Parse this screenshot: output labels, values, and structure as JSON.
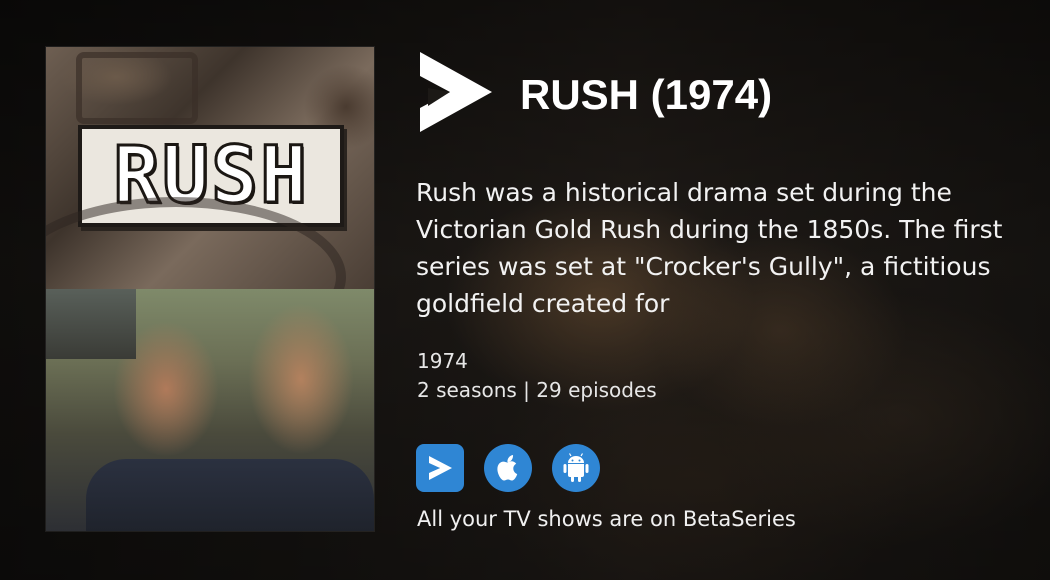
{
  "show": {
    "title": "RUSH (1974)",
    "poster_title": "RUSH",
    "description": "Rush was a historical drama set during the Victorian Gold Rush during the 1850s. The first series was set at \"Crocker's Gully\", a fictitious goldfield created for",
    "year": "1974",
    "seasons_episodes": "2 seasons | 29 episodes"
  },
  "apps": [
    {
      "icon": "betaseries-play-icon"
    },
    {
      "icon": "apple-icon"
    },
    {
      "icon": "android-icon"
    }
  ],
  "tagline": "All your TV shows are on BetaSeries",
  "colors": {
    "accent": "#2f86d4",
    "text": "#ffffff",
    "background": "#1a1816"
  }
}
